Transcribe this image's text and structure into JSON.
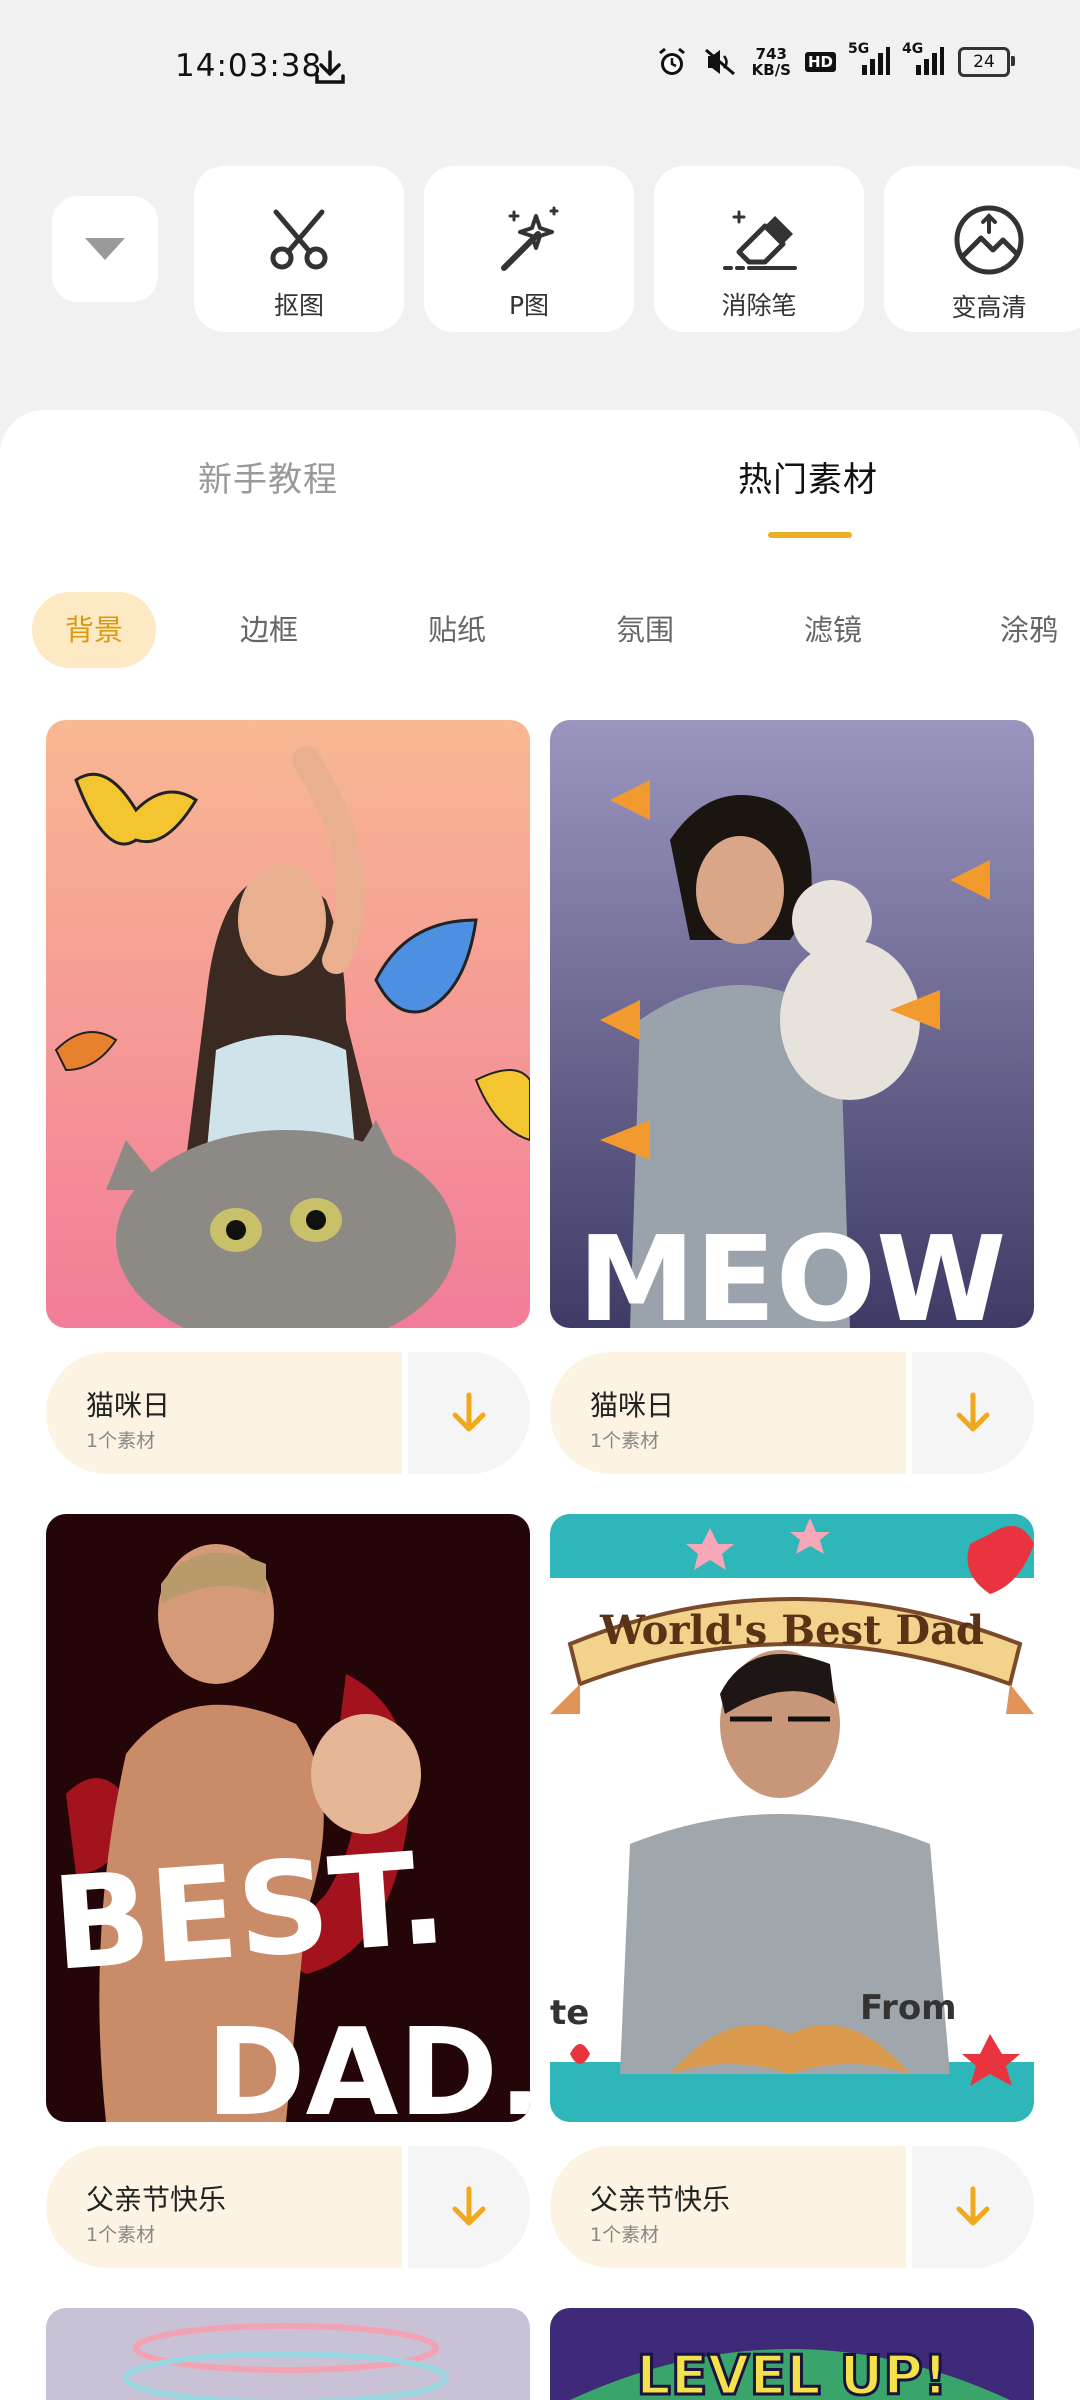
{
  "status": {
    "time": "14:03:38",
    "net_speed_value": "743",
    "net_speed_unit": "KB/S",
    "hd_badge": "HD",
    "signal_1": "5G",
    "signal_2": "4G",
    "battery": "24"
  },
  "tools": [
    {
      "label": "抠图",
      "icon": "scissors-icon"
    },
    {
      "label": "P图",
      "icon": "magic-wand-icon"
    },
    {
      "label": "消除笔",
      "icon": "eraser-icon"
    },
    {
      "label": "变高清",
      "icon": "enhance-icon"
    }
  ],
  "tabs": [
    {
      "label": "新手教程",
      "active": false
    },
    {
      "label": "热门素材",
      "active": true
    }
  ],
  "chips": [
    {
      "label": "背景",
      "active": true
    },
    {
      "label": "边框",
      "active": false
    },
    {
      "label": "贴纸",
      "active": false
    },
    {
      "label": "氛围",
      "active": false
    },
    {
      "label": "滤镜",
      "active": false
    },
    {
      "label": "涂鸦",
      "active": false
    }
  ],
  "cards": [
    {
      "title": "猫咪日",
      "subtitle": "1个素材"
    },
    {
      "title": "猫咪日",
      "subtitle": "1个素材",
      "overlay_text": "MEOW"
    },
    {
      "title": "父亲节快乐",
      "subtitle": "1个素材",
      "overlay_text_1": "BEST.",
      "overlay_text_2": "DAD."
    },
    {
      "title": "父亲节快乐",
      "subtitle": "1个素材",
      "banner_text": "World's Best Dad",
      "line_left": "te",
      "line_right": "From"
    },
    {
      "overlay_text": "LEVEL UP!"
    }
  ],
  "colors": {
    "accent": "#e9b023",
    "chip_active_bg": "#fde9c3",
    "card_info_bg": "#fdf3e3",
    "download_arrow": "#f0a81c"
  }
}
